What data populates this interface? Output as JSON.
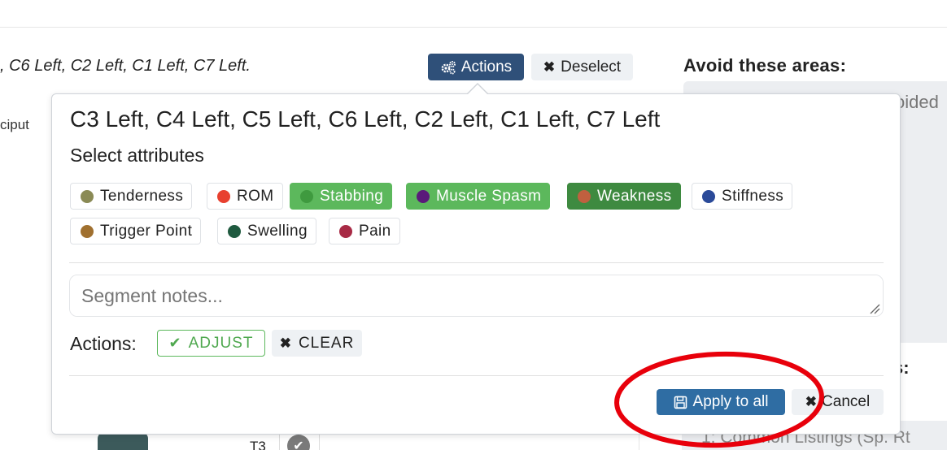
{
  "background": {
    "segment_list": ", C6 Left, C2 Left, C1 Left, C7 Left.",
    "occiput_fragment": "ciput",
    "avoid_title": "Avoid these areas:",
    "avoid_text_fragment": "oided",
    "section_colon_fragment": "s:",
    "listing_fragment": "1: Common Listings (Sp. Rt",
    "row_label": "T3"
  },
  "toolbar": {
    "actions_label": "Actions",
    "deselect_label": "Deselect"
  },
  "popover": {
    "title": "C3 Left, C4 Left, C5 Left, C6 Left, C2 Left, C1 Left, C7 Left",
    "subtitle": "Select attributes",
    "attributes": [
      {
        "label": "Tenderness",
        "color": "#8a8a55",
        "selected": false
      },
      {
        "label": "ROM",
        "color": "#e8402f",
        "selected": false
      },
      {
        "label": "Stabbing",
        "color": "#3f9a3f",
        "selected": true
      },
      {
        "label": "Muscle Spasm",
        "color": "#5a1a7a",
        "selected": true
      },
      {
        "label": "Weakness",
        "color": "#c0603f",
        "selected": true
      },
      {
        "label": "Stiffness",
        "color": "#2a4a99",
        "selected": false
      },
      {
        "label": "Trigger Point",
        "color": "#a0702f",
        "selected": false
      },
      {
        "label": "Swelling",
        "color": "#1f5a3f",
        "selected": false
      },
      {
        "label": "Pain",
        "color": "#a82a45",
        "selected": false
      }
    ],
    "notes_placeholder": "Segment notes...",
    "notes_value": "",
    "actions_label": "Actions:",
    "adjust_label": "ADJUST",
    "clear_label": "CLEAR",
    "apply_label": "Apply to all",
    "cancel_label": "Cancel"
  },
  "colors": {
    "primary": "#2f5079",
    "apply": "#2f6da3",
    "success": "#5cb85c",
    "annotation": "#e8000b"
  },
  "icons": {
    "actions": "cogs-icon",
    "deselect": "times-icon",
    "adjust": "check-icon",
    "clear": "times-icon",
    "apply": "save-icon",
    "cancel": "times-icon"
  }
}
